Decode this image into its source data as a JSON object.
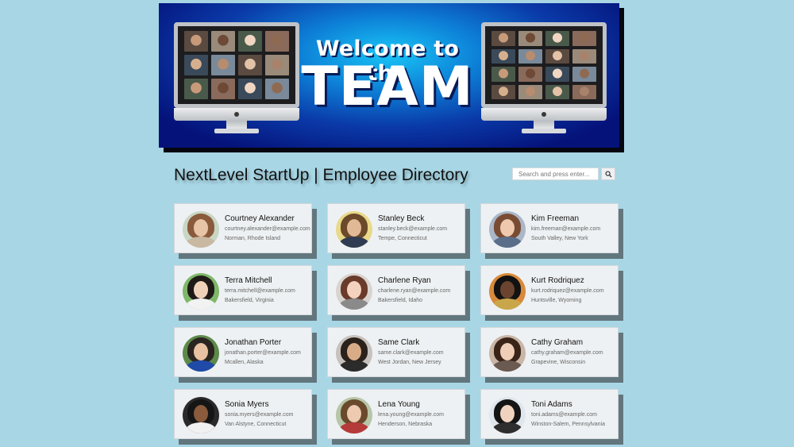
{
  "banner": {
    "welcome_text": "Welcome to the",
    "team_text": "TEAM"
  },
  "page_title": "NextLevel StartUp | Employee Directory",
  "search": {
    "placeholder": "Search and press enter...",
    "button_icon": "search-icon"
  },
  "colors": {
    "page_background": "#a8d6e5",
    "card_background": "#eef1f3",
    "banner_dark": "#05127a",
    "banner_light": "#19c6f7"
  },
  "employees": [
    {
      "name": "Courtney Alexander",
      "email": "courtney.alexander@example.com",
      "location": "Norman, Rhode Island"
    },
    {
      "name": "Stanley Beck",
      "email": "stanley.beck@example.com",
      "location": "Tempe, Connecticut"
    },
    {
      "name": "Kim Freeman",
      "email": "kim.freeman@example.com",
      "location": "South Valley, New York"
    },
    {
      "name": "Terra Mitchell",
      "email": "terra.mitchell@example.com",
      "location": "Bakersfield, Virginia"
    },
    {
      "name": "Charlene Ryan",
      "email": "charlene.ryan@example.com",
      "location": "Bakersfield, Idaho"
    },
    {
      "name": "Kurt Rodriquez",
      "email": "kurt.rodriquez@example.com",
      "location": "Huntsville, Wyoming"
    },
    {
      "name": "Jonathan Porter",
      "email": "jonathan.porter@example.com",
      "location": "Mcallen, Alaska"
    },
    {
      "name": "Same Clark",
      "email": "same.clark@example.com",
      "location": "West Jordan, New Jersey"
    },
    {
      "name": "Cathy Graham",
      "email": "cathy.graham@example.com",
      "location": "Grapevine, Wisconsin"
    },
    {
      "name": "Sonia Myers",
      "email": "sonia.myers@example.com",
      "location": "Van Alstyne, Connecticut"
    },
    {
      "name": "Lena Young",
      "email": "lena.young@example.com",
      "location": "Henderson, Nebraska"
    },
    {
      "name": "Toni Adams",
      "email": "toni.adams@example.com",
      "location": "Winston-Salem, Pennsylvania"
    }
  ]
}
